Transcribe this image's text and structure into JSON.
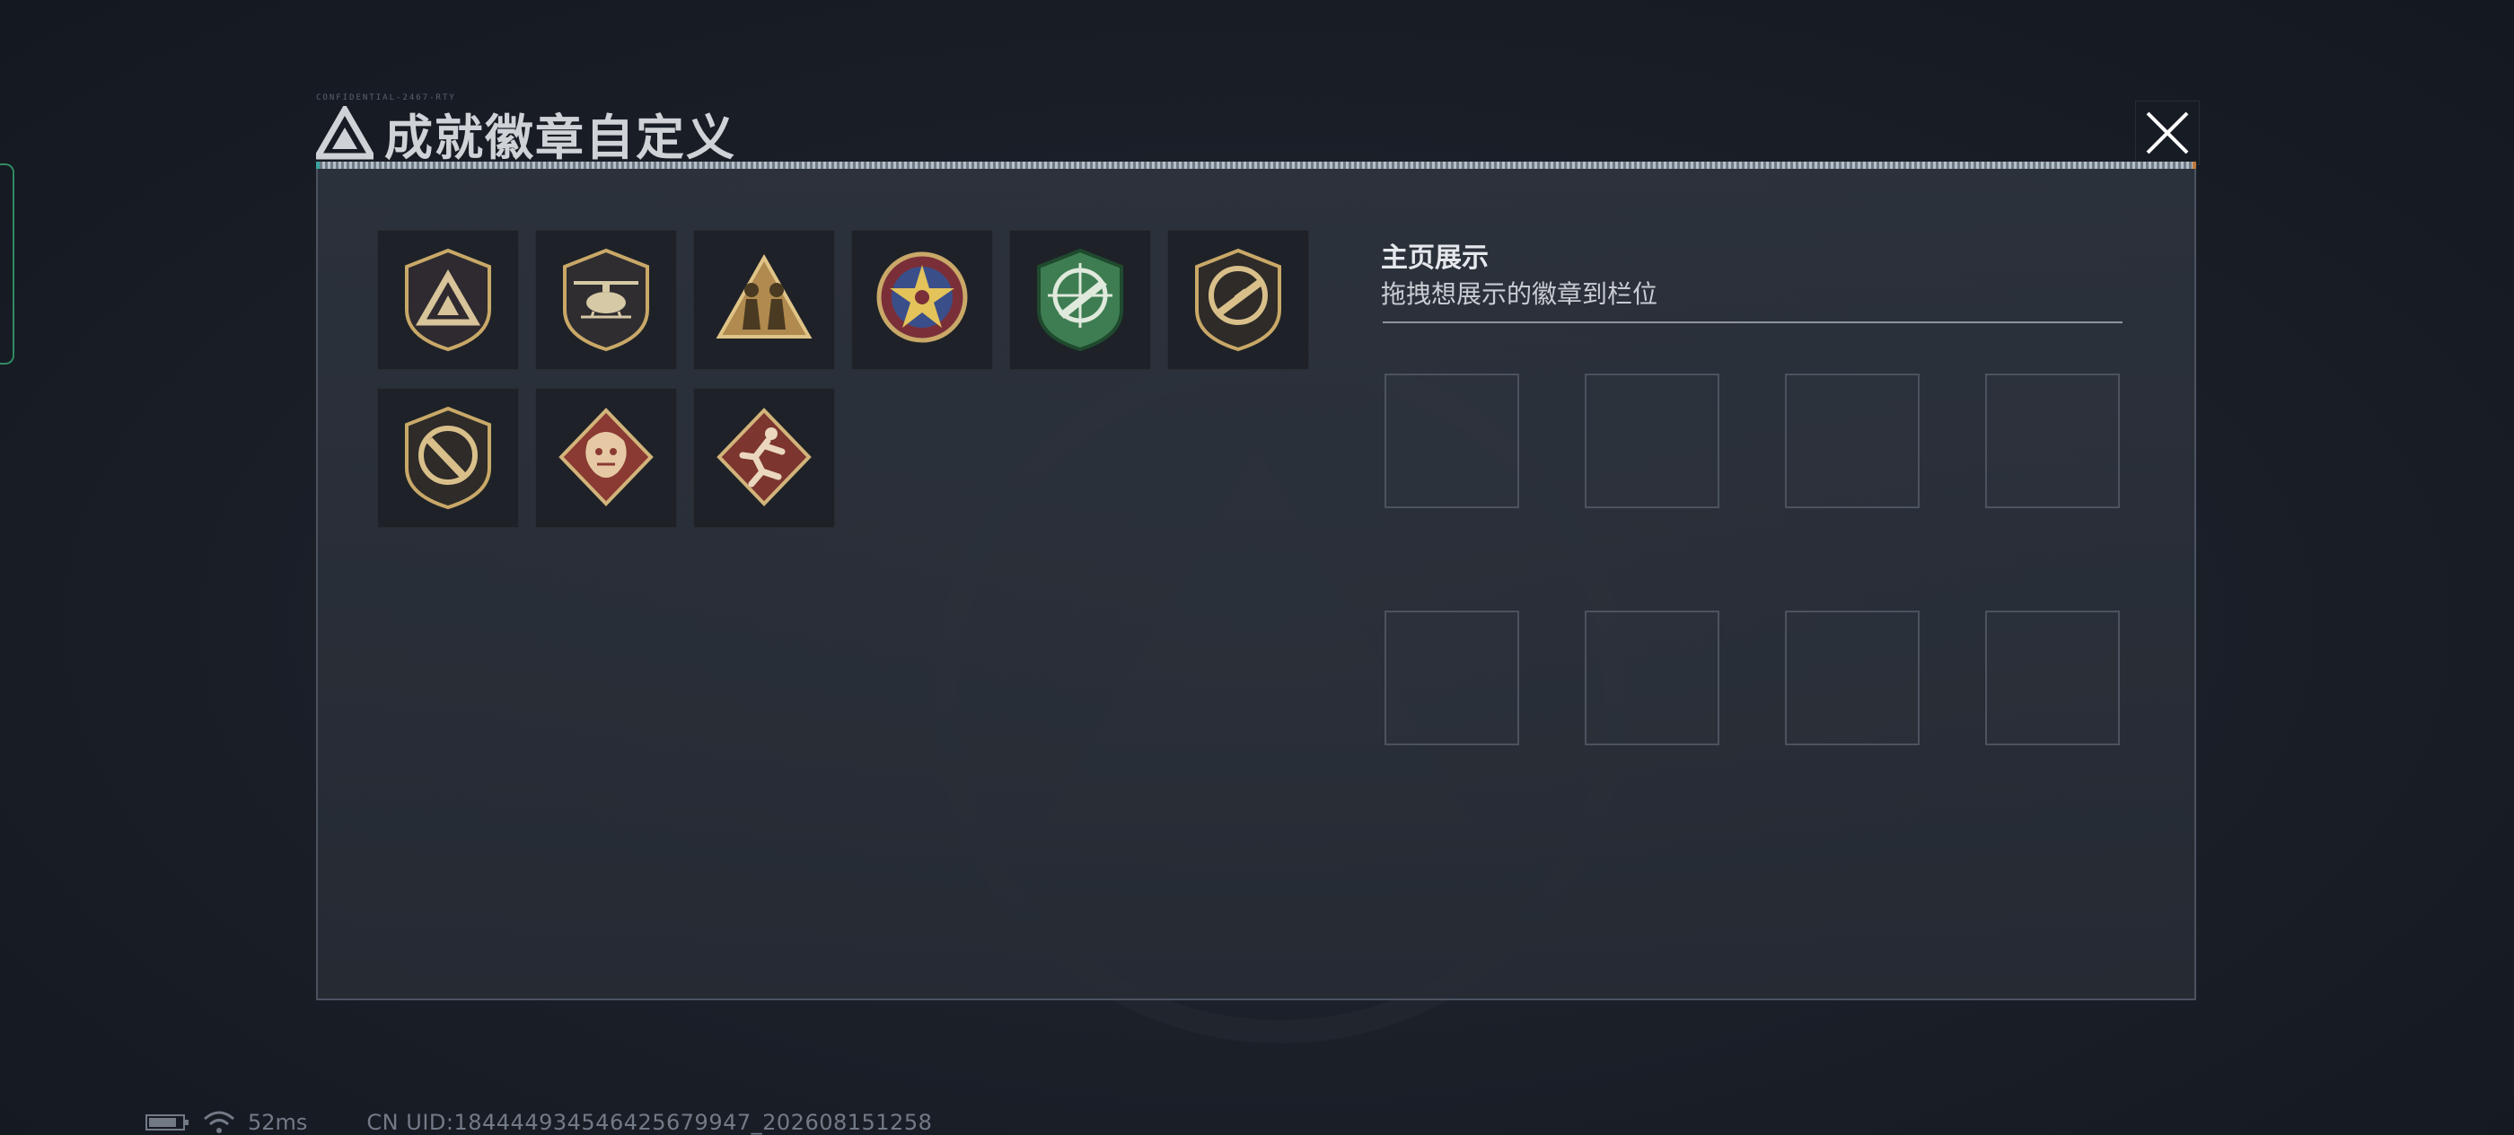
{
  "header": {
    "title": "成就徽章自定义",
    "code_text": "CONFIDENTIAL-2467-RTY"
  },
  "badges": [
    {
      "id": "b1",
      "icon": "triangle-shield-badge-icon",
      "row": 0,
      "col": 0
    },
    {
      "id": "b2",
      "icon": "helicopter-shield-badge-icon",
      "row": 0,
      "col": 1
    },
    {
      "id": "b3",
      "icon": "soldiers-triangle-badge-icon",
      "row": 0,
      "col": 2
    },
    {
      "id": "b4",
      "icon": "star-round-badge-icon",
      "row": 0,
      "col": 3
    },
    {
      "id": "b5",
      "icon": "rifle-crosshair-green-badge-icon",
      "row": 0,
      "col": 4
    },
    {
      "id": "b6",
      "icon": "rifle-crosshair-gold-badge-icon",
      "row": 0,
      "col": 5
    },
    {
      "id": "b7",
      "icon": "knife-crosshair-badge-icon",
      "row": 1,
      "col": 0
    },
    {
      "id": "b8",
      "icon": "dragon-diamond-badge-icon",
      "row": 1,
      "col": 1
    },
    {
      "id": "b9",
      "icon": "runner-diamond-badge-icon",
      "row": 1,
      "col": 2
    }
  ],
  "display": {
    "title": "主页展示",
    "subtitle": "拖拽想展示的徽章到栏位",
    "slots": [
      {
        "row": 0,
        "col": 0
      },
      {
        "row": 0,
        "col": 1
      },
      {
        "row": 0,
        "col": 2
      },
      {
        "row": 0,
        "col": 3
      },
      {
        "row": 1,
        "col": 0
      },
      {
        "row": 1,
        "col": 1
      },
      {
        "row": 1,
        "col": 2
      },
      {
        "row": 1,
        "col": 3
      }
    ]
  },
  "status": {
    "ping": "52ms",
    "uid": "CN UID:184444934546425679947_202608151258"
  },
  "colors": {
    "accent_teal": "#3aa3a0",
    "accent_orange": "#c07a3a",
    "badge_gold": "#c9a868",
    "badge_green": "#3e7d52",
    "badge_red": "#8a3a32",
    "panel_border": "#4b5361"
  }
}
